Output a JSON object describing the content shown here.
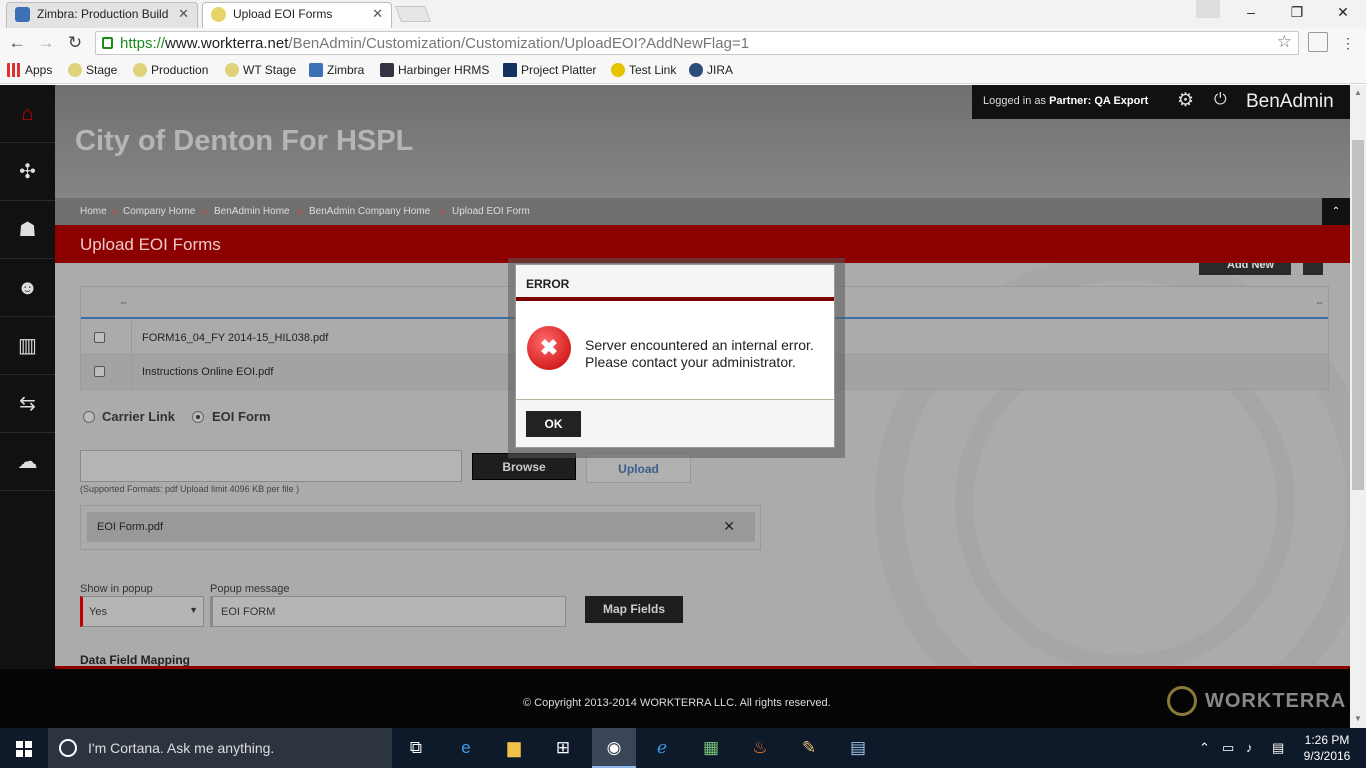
{
  "browser": {
    "tabs": [
      {
        "title": "Zimbra: Production Build",
        "active": false,
        "icon": "zimbra-icon"
      },
      {
        "title": "Upload EOI Forms",
        "active": true,
        "icon": "workterra-icon"
      }
    ],
    "url_scheme": "https://",
    "url_host": "www.workterra.net",
    "url_path": "/BenAdmin/Customization/Customization/UploadEOI?AddNewFlag=1",
    "bookmarks": [
      {
        "label": "Apps",
        "icon": "apps-grid-icon"
      },
      {
        "label": "Stage",
        "icon": "globe-icon"
      },
      {
        "label": "Production",
        "icon": "globe-icon"
      },
      {
        "label": "WT Stage",
        "icon": "globe-icon"
      },
      {
        "label": "Zimbra",
        "icon": "zimbra-icon"
      },
      {
        "label": "Harbinger HRMS",
        "icon": "harbinger-icon"
      },
      {
        "label": "Project Platter",
        "icon": "project-platter-icon"
      },
      {
        "label": "Test Link",
        "icon": "testlink-icon"
      },
      {
        "label": "JIRA",
        "icon": "jira-icon"
      }
    ]
  },
  "header": {
    "company": "City of Denton For HSPL",
    "login_prefix": "Logged in as",
    "login_role": "Partner:",
    "login_user": "QA Export",
    "brand": "BenAdmin"
  },
  "breadcrumb": [
    "Home",
    "Company Home",
    "BenAdmin Home",
    "BenAdmin Company Home",
    "Upload EOI Form"
  ],
  "page_title": "Upload EOI Forms",
  "toolbar": {
    "add_new_label": "Add New"
  },
  "grid": {
    "rows": [
      {
        "filename": "FORM16_04_FY 2014-15_HIL038.pdf"
      },
      {
        "filename": "Instructions Online EOI.pdf"
      }
    ]
  },
  "form": {
    "radio_options": [
      "Carrier Link",
      "EOI Form"
    ],
    "radio_selected": "EOI Form",
    "browse_label": "Browse",
    "upload_label": "Upload",
    "supported_formats": "(Supported Formats: pdf Upload limit 4096 KB per file )",
    "uploaded_file": "EOI Form.pdf",
    "show_in_popup_label": "Show in popup",
    "show_in_popup_value": "Yes",
    "popup_message_label": "Popup message",
    "popup_message_value": "EOI FORM",
    "map_fields_label": "Map Fields",
    "data_field_mapping": "Data Field Mapping"
  },
  "footer": {
    "copyright": "© Copyright 2013-2014 WORKTERRA LLC. All rights reserved.",
    "logo_text": "WORKTERRA"
  },
  "dialog": {
    "title": "ERROR",
    "message_line1": "Server encountered an internal error.",
    "message_line2": "Please contact your administrator.",
    "ok_label": "OK",
    "icon": "error-x-icon"
  },
  "taskbar": {
    "search_placeholder": "I'm Cortana. Ask me anything.",
    "time": "1:26 PM",
    "date": "9/3/2016"
  },
  "colors": {
    "accent_red": "#8c0000",
    "error_red": "#c40000",
    "secure_green": "#1b8a1b"
  }
}
